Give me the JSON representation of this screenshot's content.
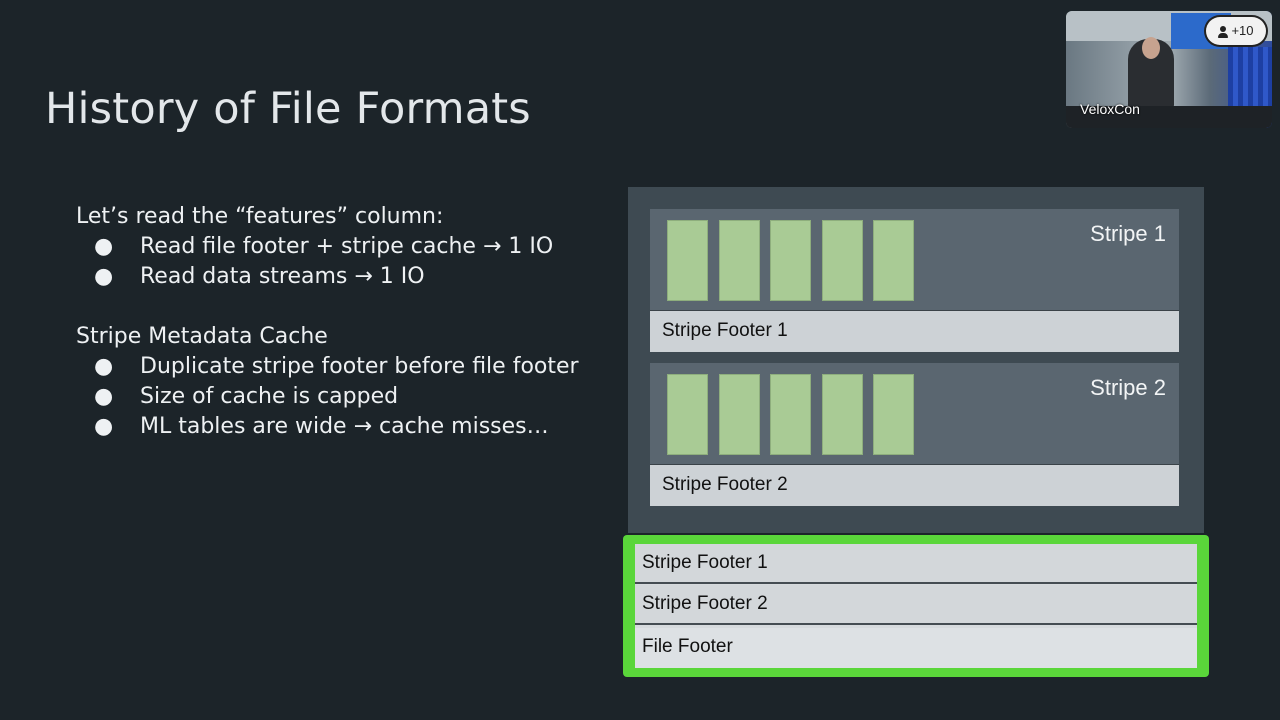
{
  "slide": {
    "title": "History of File Formats",
    "block1": {
      "heading": "Let’s read the “features” column:",
      "bullets": [
        "Read file footer + stripe cache → 1 IO",
        "Read data streams → 1 IO"
      ]
    },
    "block2": {
      "heading": "Stripe Metadata Cache",
      "bullets": [
        "Duplicate stripe footer before file footer",
        "Size of cache is capped",
        "ML tables are wide → cache misses…"
      ]
    },
    "bullet_glyph": "●"
  },
  "diagram": {
    "stripes": [
      {
        "label": "Stripe 1",
        "footer": "Stripe Footer 1",
        "column_count": 5
      },
      {
        "label": "Stripe 2",
        "footer": "Stripe Footer 2",
        "column_count": 5
      }
    ],
    "cache": {
      "rows": [
        "Stripe Footer 1",
        "Stripe Footer 2",
        "File Footer"
      ]
    },
    "colors": {
      "column_fill": "#a9cb95",
      "cache_highlight": "#5ad63a",
      "stripe_bg": "#5a6670",
      "file_bg": "#3e4a52"
    }
  },
  "video": {
    "name_label": "VeloxCon",
    "participants_badge": "+10",
    "participants_icon": "user-icon"
  }
}
